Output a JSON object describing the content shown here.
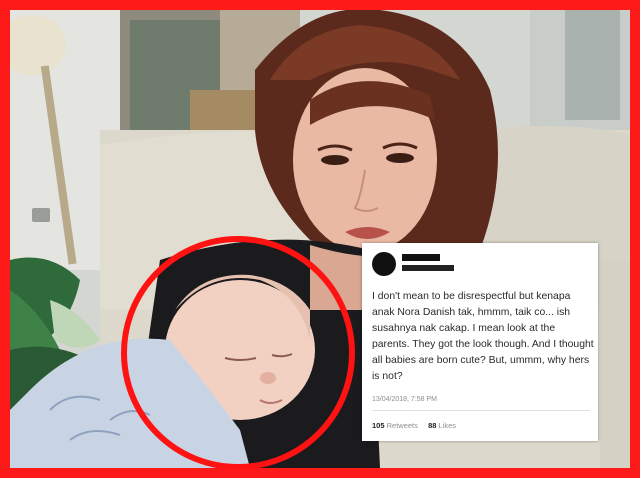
{
  "tweet": {
    "text": "I don't mean to be disrespectful but kenapa anak Nora Danish tak, hmmm, taik co... ish susahnya nak cakap. I mean look at the parents. They got the look though. And I thought all babies are born cute? But, ummm, why hers is not?",
    "timestamp": "13/04/2018, 7:58 PM",
    "retweets_count": "105",
    "retweets_label": "Retweets",
    "likes_count": "88",
    "likes_label": "Likes"
  },
  "colors": {
    "frame": "#ff1a1a",
    "circle": "#ff1212",
    "tweet_background": "#ffffff"
  }
}
